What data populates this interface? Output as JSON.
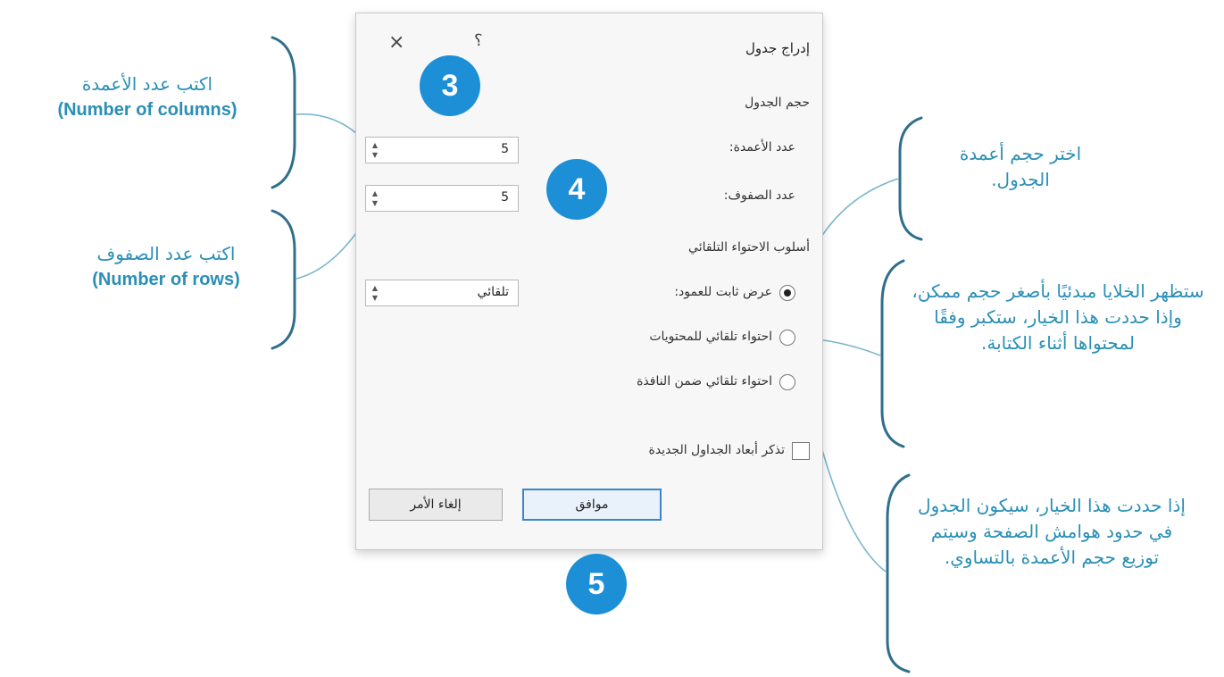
{
  "dialog": {
    "title": "إدراج جدول",
    "close_label": "×",
    "help_label": "؟",
    "size_heading": "حجم الجدول",
    "columns_label": "عدد الأعمدة:",
    "columns_value": "5",
    "rows_label": "عدد الصفوف:",
    "rows_value": "5",
    "autofit_heading": "أسلوب الاحتواء التلقائي",
    "fixed_width_option": "عرض ثابت للعمود:",
    "fixed_width_value": "تلقائي",
    "autofit_contents_option": "احتواء تلقائي للمحتويات",
    "autofit_window_option": "احتواء تلقائي ضمن النافذة",
    "remember_label": "تذكر أبعاد الجداول الجديدة",
    "ok_label": "موافق",
    "cancel_label": "إلغاء الأمر"
  },
  "badges": {
    "three": "3",
    "four": "4",
    "five": "5"
  },
  "annotations": {
    "columns_ar": "اكتب عدد الأعمدة",
    "columns_en": "(Number of columns)",
    "rows_ar": "اكتب عدد الصفوف",
    "rows_en": "(Number of rows)",
    "size_note": "اختر حجم أعمدة الجدول.",
    "contents_note": "ستظهر الخلايا مبدئيًا بأصغر حجم ممكن، وإذا حددت هذا الخيار، ستكبر وفقًا لمحتواها أثناء الكتابة.",
    "window_note": "إذا حددت هذا الخيار، سيكون الجدول في حدود هوامش الصفحة وسيتم توزيع حجم الأعمدة بالتساوي."
  },
  "colors": {
    "badge": "#1d8fd6",
    "annotation_text": "#2a8fb5",
    "bracket": "#2f6f8c"
  }
}
